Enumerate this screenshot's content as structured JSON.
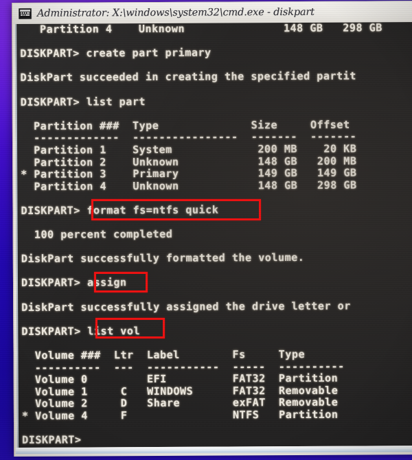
{
  "window": {
    "title": "Administrator: X:\\windows\\system32\\cmd.exe - diskpart",
    "app_icon": "cmd-console-icon",
    "prompt": "DISKPART>"
  },
  "colors": {
    "console_background": "#232222",
    "console_text": "#f0ece3",
    "titlebar_background": "#eceae5",
    "titlebar_text": "#2e2e34",
    "annotation_red": "#ee1111",
    "desktop_background": "#2408b4"
  },
  "terminal": {
    "lines": [
      "   Partition 4    Unknown               148 GB   298 GB",
      "",
      "DISKPART> create part primary",
      "",
      "DiskPart succeeded in creating the specified partit",
      "",
      "DISKPART> list part",
      "",
      "  Partition ###  Type              Size     Offset",
      "  -------------  ----------------  -------  -------",
      "  Partition 1    System             200 MB    20 KB",
      "  Partition 2    Unknown            148 GB   200 MB",
      "* Partition 3    Primary            149 GB   149 GB",
      "  Partition 4    Unknown            148 GB   298 GB",
      "",
      "DISKPART> format fs=ntfs quick",
      "",
      "  100 percent completed",
      "",
      "DiskPart successfully formatted the volume.",
      "",
      "DISKPART> assign",
      "",
      "DiskPart successfully assigned the drive letter or",
      "",
      "DISKPART> list vol",
      "",
      "  Volume ###  Ltr  Label        Fs     Type",
      "  ----------  ---  -----------  -----  ----------",
      "  Volume 0         EFI          FAT32  Partition",
      "  Volume 1     C   WINDOWS      FAT32  Removable",
      "  Volume 2     D   Share        exFAT  Removable",
      "* Volume 4     F                NTFS   Partition",
      "",
      "DISKPART>"
    ]
  },
  "commands": {
    "create_partition": "create part primary",
    "list_partition": "list part",
    "format": "format fs=ntfs quick",
    "assign": "assign",
    "list_volume": "list vol"
  },
  "partition_table": {
    "headers": [
      "Partition ###",
      "Type",
      "Size",
      "Offset"
    ],
    "rows": [
      {
        "selected": false,
        "name": "Partition 1",
        "type": "System",
        "size": "200 MB",
        "offset": "20 KB"
      },
      {
        "selected": false,
        "name": "Partition 2",
        "type": "Unknown",
        "size": "148 GB",
        "offset": "200 MB"
      },
      {
        "selected": true,
        "name": "Partition 3",
        "type": "Primary",
        "size": "149 GB",
        "offset": "149 GB"
      },
      {
        "selected": false,
        "name": "Partition 4",
        "type": "Unknown",
        "size": "148 GB",
        "offset": "298 GB"
      }
    ]
  },
  "volume_table": {
    "headers": [
      "Volume ###",
      "Ltr",
      "Label",
      "Fs",
      "Type"
    ],
    "rows": [
      {
        "selected": false,
        "name": "Volume 0",
        "ltr": "",
        "label": "EFI",
        "fs": "FAT32",
        "type": "Partition"
      },
      {
        "selected": false,
        "name": "Volume 1",
        "ltr": "C",
        "label": "WINDOWS",
        "fs": "FAT32",
        "type": "Removable"
      },
      {
        "selected": false,
        "name": "Volume 2",
        "ltr": "D",
        "label": "Share",
        "fs": "exFAT",
        "type": "Removable"
      },
      {
        "selected": true,
        "name": "Volume 4",
        "ltr": "F",
        "label": "",
        "fs": "NTFS",
        "type": "Partition"
      }
    ]
  },
  "messages": {
    "create_success": "DiskPart succeeded in creating the specified partit",
    "format_progress": "100 percent completed",
    "format_success": "DiskPart successfully formatted the volume.",
    "assign_success": "DiskPart successfully assigned the drive letter or"
  },
  "annotations": [
    {
      "target": "format fs=ntfs quick",
      "name": "annotation-format-command"
    },
    {
      "target": "assign",
      "name": "annotation-assign-command"
    },
    {
      "target": "list vol",
      "name": "annotation-list-vol-command"
    }
  ]
}
